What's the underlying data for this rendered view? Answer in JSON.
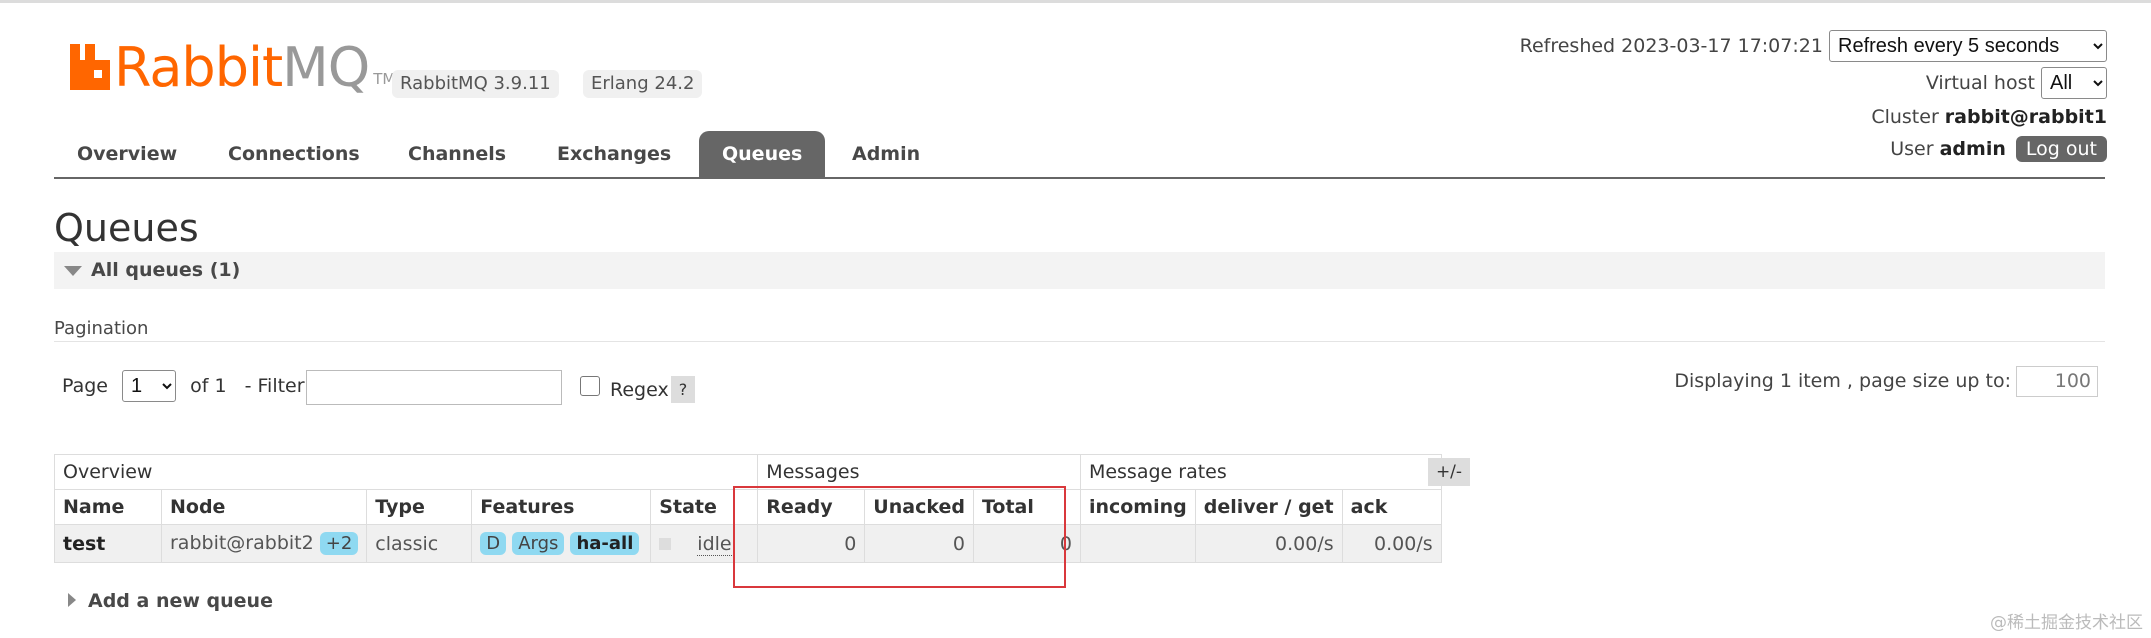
{
  "header": {
    "logo_brand": "Rabbit",
    "logo_suffix": "MQ",
    "logo_tm": "TM",
    "version_badge": "RabbitMQ 3.9.11",
    "erlang_badge": "Erlang 24.2",
    "refreshed_label": "Refreshed 2023-03-17 17:07:21",
    "refresh_select": "Refresh every 5 seconds",
    "virtual_host_label": "Virtual host",
    "virtual_host_select": "All",
    "cluster_label": "Cluster",
    "cluster_value": "rabbit@rabbit1",
    "user_label": "User",
    "user_value": "admin",
    "logout_label": "Log out"
  },
  "tabs": [
    {
      "label": "Overview"
    },
    {
      "label": "Connections"
    },
    {
      "label": "Channels"
    },
    {
      "label": "Exchanges"
    },
    {
      "label": "Queues",
      "active": true
    },
    {
      "label": "Admin"
    }
  ],
  "page": {
    "title": "Queues",
    "section_label": "All queues (1)",
    "pagination_title": "Pagination",
    "page_label": "Page",
    "page_select": "1",
    "of_label": "of 1",
    "filter_label": "- Filter:",
    "filter_value": "",
    "regex_label": "Regex",
    "help_label": "?",
    "display_text": "Displaying 1 item , page size up to:",
    "page_size": "100",
    "plusminus_label": "+/-",
    "add_queue_label": "Add a new queue",
    "watermark": "@稀土掘金技术社区"
  },
  "table": {
    "groups": {
      "overview": "Overview",
      "messages": "Messages",
      "rates": "Message rates"
    },
    "columns": {
      "name": "Name",
      "node": "Node",
      "type": "Type",
      "features": "Features",
      "state": "State",
      "ready": "Ready",
      "unacked": "Unacked",
      "total": "Total",
      "incoming": "incoming",
      "deliver_get": "deliver / get",
      "ack": "ack"
    },
    "row": {
      "name": "test",
      "node": "rabbit@rabbit2",
      "node_extra": "+2",
      "type": "classic",
      "feature_d": "D",
      "feature_args": "Args",
      "feature_policy": "ha-all",
      "state": "idle",
      "ready": "0",
      "unacked": "0",
      "total": "0",
      "incoming": "",
      "deliver_get": "0.00/s",
      "ack": "0.00/s"
    }
  },
  "colors": {
    "brand_orange": "#ff6600",
    "tab_active": "#666666",
    "pill_blue": "#8fd9f1",
    "highlight_red": "#d9383c"
  }
}
